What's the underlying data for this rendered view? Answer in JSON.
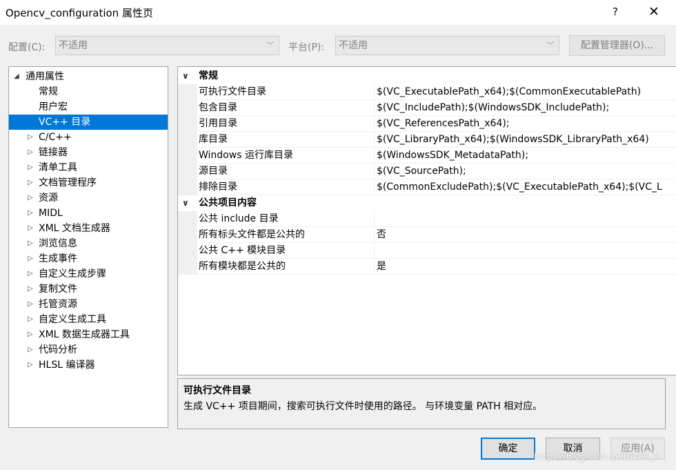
{
  "window": {
    "title": "Opencv_configuration 属性页",
    "help_label": "?",
    "close_label": "✕"
  },
  "config_bar": {
    "config_label": "配置(C):",
    "config_value": "不适用",
    "platform_label": "平台(P):",
    "platform_value": "不适用",
    "manager_button": "配置管理器(O)..."
  },
  "tree": {
    "items": [
      {
        "label": "通用属性",
        "expander": "◢",
        "level": 0,
        "selected": false
      },
      {
        "label": "常规",
        "expander": "",
        "level": 1,
        "selected": false
      },
      {
        "label": "用户宏",
        "expander": "",
        "level": 1,
        "selected": false
      },
      {
        "label": "VC++ 目录",
        "expander": "",
        "level": 1,
        "selected": true
      },
      {
        "label": "C/C++",
        "expander": "▷",
        "level": 1,
        "selected": false
      },
      {
        "label": "链接器",
        "expander": "▷",
        "level": 1,
        "selected": false
      },
      {
        "label": "清单工具",
        "expander": "▷",
        "level": 1,
        "selected": false
      },
      {
        "label": "文档管理程序",
        "expander": "▷",
        "level": 1,
        "selected": false
      },
      {
        "label": "资源",
        "expander": "▷",
        "level": 1,
        "selected": false
      },
      {
        "label": "MIDL",
        "expander": "▷",
        "level": 1,
        "selected": false
      },
      {
        "label": "XML 文档生成器",
        "expander": "▷",
        "level": 1,
        "selected": false
      },
      {
        "label": "浏览信息",
        "expander": "▷",
        "level": 1,
        "selected": false
      },
      {
        "label": "生成事件",
        "expander": "▷",
        "level": 1,
        "selected": false
      },
      {
        "label": "自定义生成步骤",
        "expander": "▷",
        "level": 1,
        "selected": false
      },
      {
        "label": "复制文件",
        "expander": "▷",
        "level": 1,
        "selected": false
      },
      {
        "label": "托管资源",
        "expander": "▷",
        "level": 1,
        "selected": false
      },
      {
        "label": "自定义生成工具",
        "expander": "▷",
        "level": 1,
        "selected": false
      },
      {
        "label": "XML 数据生成器工具",
        "expander": "▷",
        "level": 1,
        "selected": false
      },
      {
        "label": "代码分析",
        "expander": "▷",
        "level": 1,
        "selected": false
      },
      {
        "label": "HLSL 编译器",
        "expander": "▷",
        "level": 1,
        "selected": false
      }
    ]
  },
  "grid": {
    "categories": [
      {
        "label": "常规",
        "chevron": "∨",
        "rows": [
          {
            "name": "可执行文件目录",
            "value": "$(VC_ExecutablePath_x64);$(CommonExecutablePath)"
          },
          {
            "name": "包含目录",
            "value": "$(VC_IncludePath);$(WindowsSDK_IncludePath);"
          },
          {
            "name": "引用目录",
            "value": "$(VC_ReferencesPath_x64);"
          },
          {
            "name": "库目录",
            "value": "$(VC_LibraryPath_x64);$(WindowsSDK_LibraryPath_x64)"
          },
          {
            "name": "Windows 运行库目录",
            "value": "$(WindowsSDK_MetadataPath);"
          },
          {
            "name": "源目录",
            "value": "$(VC_SourcePath);"
          },
          {
            "name": "排除目录",
            "value": "$(CommonExcludePath);$(VC_ExecutablePath_x64);$(VC_L"
          }
        ]
      },
      {
        "label": "公共项目内容",
        "chevron": "∨",
        "rows": [
          {
            "name": "公共 include 目录",
            "value": ""
          },
          {
            "name": "所有标头文件都是公共的",
            "value": "否"
          },
          {
            "name": "公共 C++ 模块目录",
            "value": ""
          },
          {
            "name": "所有模块都是公共的",
            "value": "是"
          }
        ]
      }
    ]
  },
  "description": {
    "title": "可执行文件目录",
    "text": "生成 VC++ 项目期间，搜索可执行文件时使用的路径。 与环境变量 PATH 相对应。"
  },
  "buttons": {
    "ok": "确定",
    "cancel": "取消",
    "apply": "应用(A)"
  },
  "watermark": "https://blog.csdn.net/Ivan_9",
  "colors": {
    "selection": "#0078d7",
    "window_bg": "#f0f0f0"
  }
}
